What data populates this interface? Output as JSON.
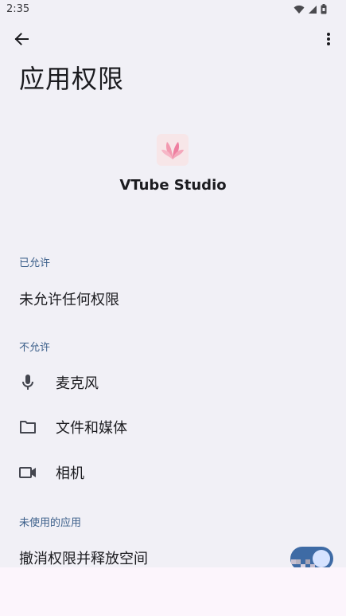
{
  "status_bar": {
    "time": "2:35",
    "icons": [
      "wifi-icon",
      "signal-icon",
      "battery-icon"
    ]
  },
  "toolbar": {
    "back_icon": "arrow-back-icon",
    "more_icon": "more-vert-icon"
  },
  "page": {
    "title": "应用权限"
  },
  "app": {
    "name": "VTube Studio",
    "icon": "vtube-studio-app-icon"
  },
  "sections": {
    "allowed": {
      "header": "已允许",
      "empty_text": "未允许任何权限"
    },
    "denied": {
      "header": "不允许",
      "items": [
        {
          "label": "麦克风",
          "icon": "microphone-icon"
        },
        {
          "label": "文件和媒体",
          "icon": "folder-icon"
        },
        {
          "label": "相机",
          "icon": "videocam-icon"
        }
      ]
    },
    "unused": {
      "header": "未使用的应用",
      "toggle_label": "撤消权限并释放空间",
      "toggle_on": true
    }
  },
  "colors": {
    "background": "#f1f0f6",
    "section_header": "#3c5f8a",
    "toggle_track": "#3e6ba5",
    "toggle_knob": "#d6e3ff",
    "bottom_panel": "#fcf5fc"
  }
}
